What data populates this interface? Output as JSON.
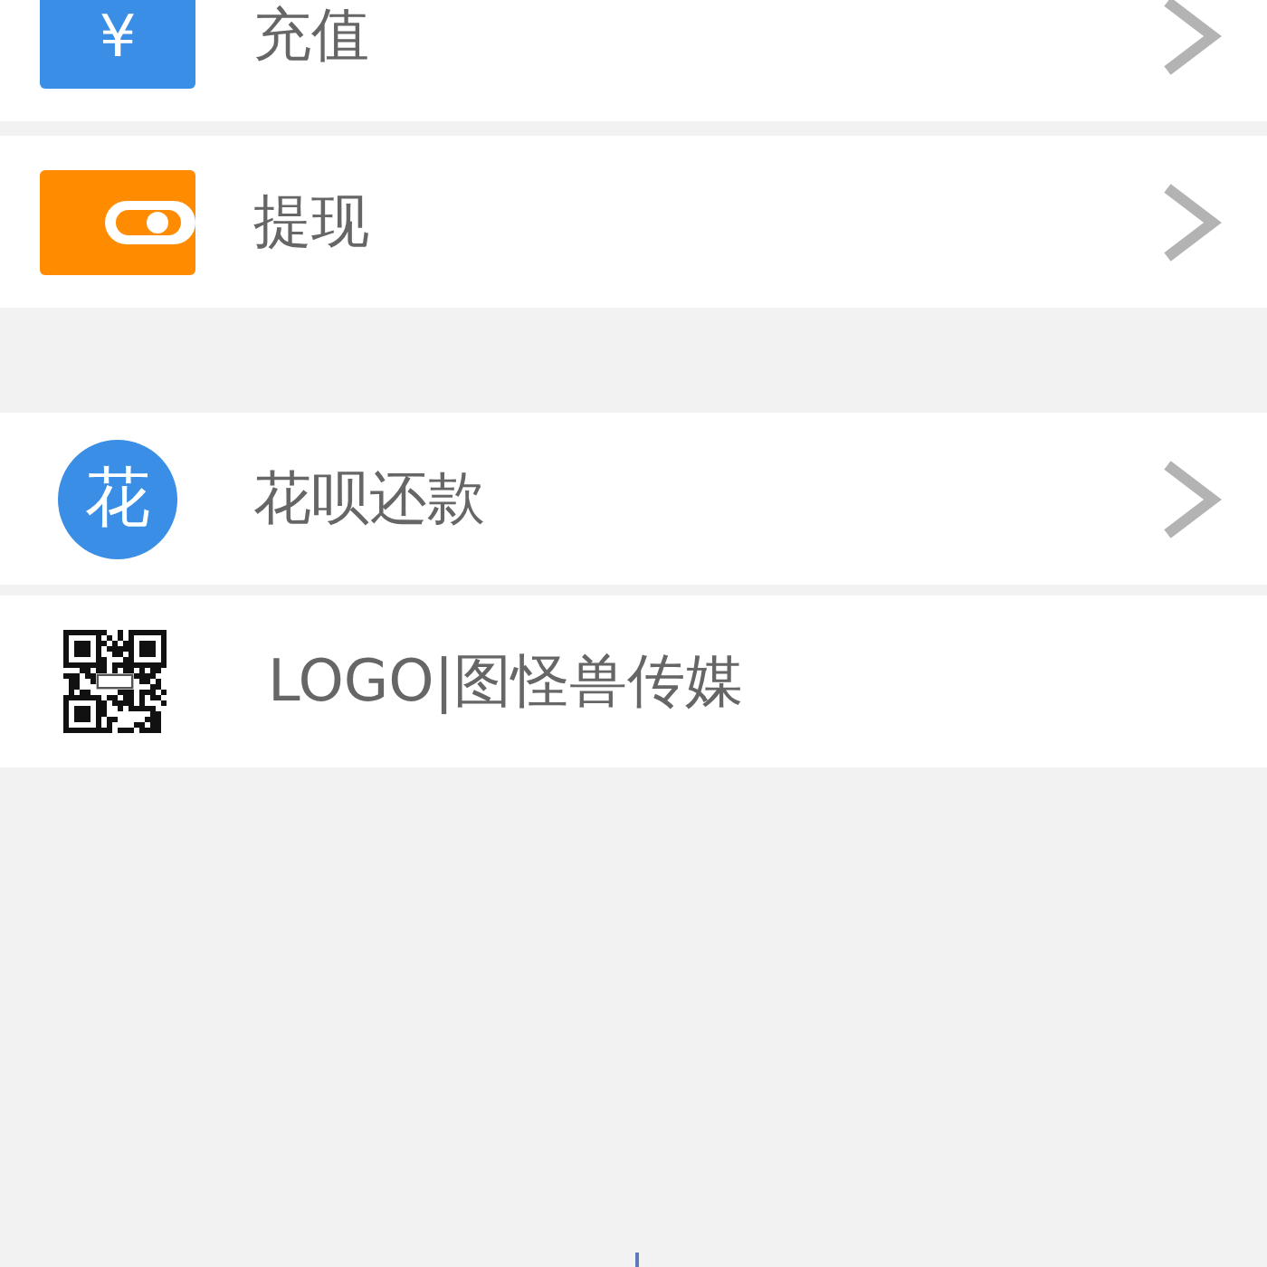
{
  "groups": [
    {
      "items": [
        {
          "kind": "yuan",
          "icon_text": "¥",
          "label": "充值",
          "chevron": true
        },
        {
          "kind": "wallet",
          "label": "提现",
          "chevron": true
        }
      ]
    },
    {
      "items": [
        {
          "kind": "circle",
          "icon_text": "花",
          "label": "花呗还款",
          "chevron": true
        },
        {
          "kind": "qr",
          "label": "LOGO|图怪兽传媒",
          "chevron": false
        }
      ]
    }
  ]
}
